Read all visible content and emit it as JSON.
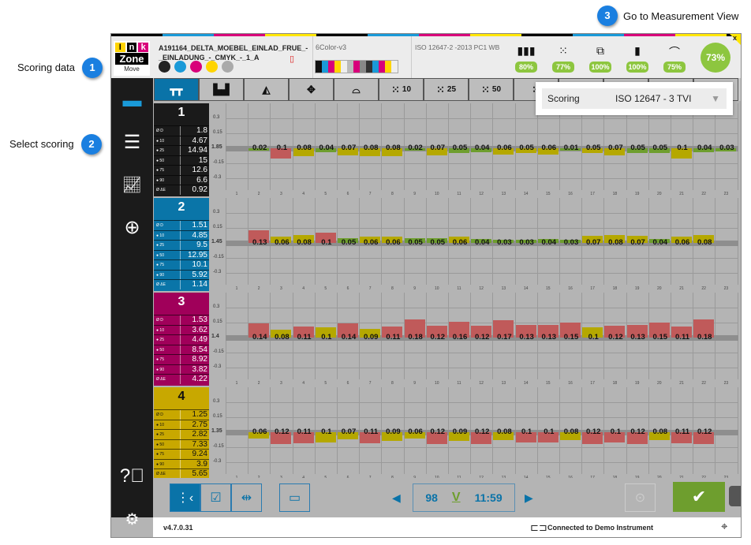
{
  "callouts": [
    {
      "num": "1",
      "label": "Scoring data"
    },
    {
      "num": "2",
      "label": "Select scoring"
    },
    {
      "num": "3",
      "label": "Go to Measurement View"
    }
  ],
  "header": {
    "logo_letters": [
      "I",
      "n",
      "k"
    ],
    "logo_word": "Zone",
    "logo_sub": "Move",
    "job_title_1": "A191164_DELTA_MOEBEL_EINLAD_FRUE_-",
    "job_title_2": "_EINLADUNG_-_CMYK_-_1_A",
    "profile": "6Color-v3",
    "standard": "ISO 12647-2 -2013 PC1 WB",
    "scores": [
      {
        "icon": "cmyk-bar-icon",
        "value": "80%"
      },
      {
        "icon": "dot-grid-icon",
        "value": "77%"
      },
      {
        "icon": "overprint-icon",
        "value": "100%"
      },
      {
        "icon": "page-icon",
        "value": "100%"
      },
      {
        "icon": "tone-curve-icon",
        "value": "75%"
      }
    ],
    "total_score": "73%",
    "close": "x"
  },
  "tabs": [
    {
      "icon": "paper-white-icon",
      "label": ""
    },
    {
      "icon": "bar-chart-icon",
      "label": ""
    },
    {
      "icon": "gamut-icon",
      "label": ""
    },
    {
      "icon": "registration-icon",
      "label": ""
    },
    {
      "icon": "tvi-curve-icon",
      "label": ""
    },
    {
      "icon": "dot-grid-icon",
      "label": "10"
    },
    {
      "icon": "dot-grid-icon",
      "label": "25"
    },
    {
      "icon": "dot-grid-icon",
      "label": "50"
    },
    {
      "icon": "dot-grid-icon",
      "label": ""
    }
  ],
  "scoring_dropdown": {
    "label": "Scoring",
    "value": "ISO 12647 -  3 TVI"
  },
  "colors": {
    "accent": "#0a73a8",
    "green": "#6e9e2e",
    "yellow": "#b5a800",
    "red": "#c05a5a",
    "score_green": "#8dc63f"
  },
  "chart_data": {
    "type": "bar",
    "yticks": [
      "0.3",
      "0.15",
      "-0.15",
      "-0.3"
    ],
    "ylim": [
      -0.3,
      0.3
    ],
    "columns": [
      "1",
      "2",
      "3",
      "4",
      "5",
      "6",
      "7",
      "8",
      "9",
      "10",
      "11",
      "12",
      "13",
      "14",
      "15",
      "16",
      "17",
      "18",
      "19",
      "20",
      "21",
      "22",
      "23"
    ],
    "rows": [
      {
        "number": "1",
        "panel_color": "#1a1a1a",
        "text_color": "#ffffff",
        "base": "1.85",
        "direction": "down",
        "stats": [
          [
            "Ø D",
            "1.8"
          ],
          [
            "● 10",
            "4.67"
          ],
          [
            "● 25",
            "14.94"
          ],
          [
            "● 50",
            "15"
          ],
          [
            "● 75",
            "12.6"
          ],
          [
            "● 90",
            "6.6"
          ],
          [
            "Ø ΔE",
            "0.92"
          ]
        ],
        "values": [
          0.02,
          0.1,
          0.08,
          0.04,
          0.07,
          0.08,
          0.08,
          0.02,
          0.07,
          0.05,
          0.04,
          0.06,
          0.05,
          0.06,
          0.01,
          0.05,
          0.07,
          0.05,
          0.05,
          0.1,
          0.04,
          0.03
        ],
        "status": "gryg yyyg ygg yyy gyy ggy gg"
      },
      {
        "number": "2",
        "panel_color": "#0a75a8",
        "text_color": "#ffffff",
        "base": "1.45",
        "direction": "up",
        "stats": [
          [
            "Ø D",
            "1.51"
          ],
          [
            "● 10",
            "4.85"
          ],
          [
            "● 25",
            "9.5"
          ],
          [
            "● 50",
            "12.95"
          ],
          [
            "● 75",
            "10.1"
          ],
          [
            "● 90",
            "5.92"
          ],
          [
            "Ø ΔE",
            "1.14"
          ]
        ],
        "values": [
          0.13,
          0.06,
          0.08,
          0.1,
          0.05,
          0.06,
          0.06,
          0.05,
          0.05,
          0.06,
          0.04,
          0.03,
          0.03,
          0.04,
          0.03,
          0.07,
          0.08,
          0.07,
          0.04,
          0.06,
          0.08
        ],
        "status": "ryyr gyyg gyg ggg gyy ygy y"
      },
      {
        "number": "3",
        "panel_color": "#a0005a",
        "text_color": "#ffffff",
        "base": "1.4",
        "direction": "up",
        "stats": [
          [
            "Ø D",
            "1.53"
          ],
          [
            "● 10",
            "3.62"
          ],
          [
            "● 25",
            "4.49"
          ],
          [
            "● 50",
            "8.54"
          ],
          [
            "● 75",
            "8.92"
          ],
          [
            "● 90",
            "3.82"
          ],
          [
            "Ø ΔE",
            "4.22"
          ]
        ],
        "values": [
          0.14,
          0.08,
          0.11,
          0.1,
          0.14,
          0.09,
          0.11,
          0.18,
          0.12,
          0.16,
          0.12,
          0.17,
          0.13,
          0.13,
          0.15,
          0.1,
          0.12,
          0.13,
          0.15,
          0.11,
          0.18
        ],
        "status": "ryry ryrr rrr rrr ryr rrr r"
      },
      {
        "number": "4",
        "panel_color": "#c8a800",
        "text_color": "#111111",
        "base": "1.35",
        "direction": "down",
        "stats": [
          [
            "Ø D",
            "1.25"
          ],
          [
            "● 10",
            "2.75"
          ],
          [
            "● 25",
            "2.82"
          ],
          [
            "● 50",
            "7.33"
          ],
          [
            "● 75",
            "9.24"
          ],
          [
            "● 90",
            "3.9"
          ],
          [
            "Ø ΔE",
            "5.65"
          ]
        ],
        "values": [
          0.06,
          0.12,
          0.11,
          0.1,
          0.07,
          0.11,
          0.09,
          0.06,
          0.12,
          0.09,
          0.12,
          0.08,
          0.1,
          0.1,
          0.08,
          0.12,
          0.1,
          0.12,
          0.08,
          0.11,
          0.12
        ],
        "status": "yrry yryy ryr yrr yrr ryr r"
      }
    ]
  },
  "bottom": {
    "counter": "98",
    "check": "V",
    "time": "11:59"
  },
  "footer": {
    "version": "v4.7.0.31",
    "connection": "Connected to Demo Instrument"
  }
}
